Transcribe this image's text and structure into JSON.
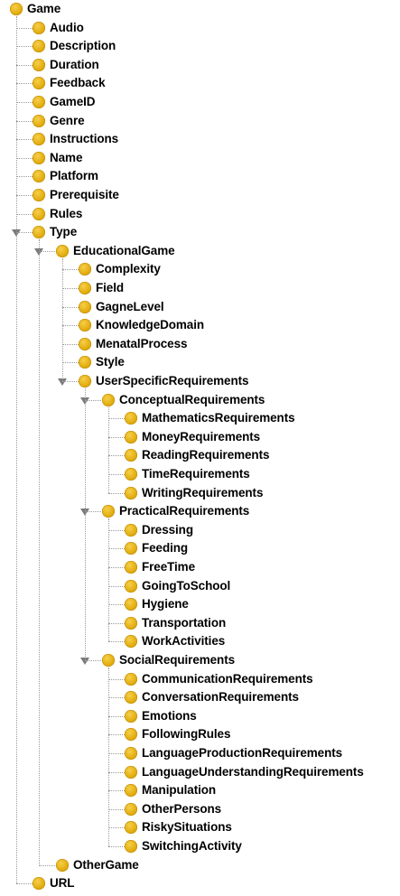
{
  "tree": {
    "label": "Game",
    "children": [
      {
        "label": "Audio"
      },
      {
        "label": "Description"
      },
      {
        "label": "Duration"
      },
      {
        "label": "Feedback"
      },
      {
        "label": "GameID"
      },
      {
        "label": "Genre"
      },
      {
        "label": "Instructions"
      },
      {
        "label": "Name"
      },
      {
        "label": "Platform"
      },
      {
        "label": "Prerequisite"
      },
      {
        "label": "Rules"
      },
      {
        "label": "Type",
        "expanded": true,
        "children": [
          {
            "label": "EducationalGame",
            "expanded": true,
            "children": [
              {
                "label": "Complexity"
              },
              {
                "label": "Field"
              },
              {
                "label": "GagneLevel"
              },
              {
                "label": "KnowledgeDomain"
              },
              {
                "label": "MenatalProcess"
              },
              {
                "label": "Style"
              },
              {
                "label": "UserSpecificRequirements",
                "expanded": true,
                "children": [
                  {
                    "label": "ConceptualRequirements",
                    "expanded": true,
                    "children": [
                      {
                        "label": "MathematicsRequirements"
                      },
                      {
                        "label": "MoneyRequirements"
                      },
                      {
                        "label": "ReadingRequirements"
                      },
                      {
                        "label": "TimeRequirements"
                      },
                      {
                        "label": "WritingRequirements"
                      }
                    ]
                  },
                  {
                    "label": "PracticalRequirements",
                    "expanded": true,
                    "children": [
                      {
                        "label": "Dressing"
                      },
                      {
                        "label": "Feeding"
                      },
                      {
                        "label": "FreeTime"
                      },
                      {
                        "label": "GoingToSchool"
                      },
                      {
                        "label": "Hygiene"
                      },
                      {
                        "label": "Transportation"
                      },
                      {
                        "label": "WorkActivities"
                      }
                    ]
                  },
                  {
                    "label": "SocialRequirements",
                    "expanded": true,
                    "children": [
                      {
                        "label": "CommunicationRequirements"
                      },
                      {
                        "label": "ConversationRequirements"
                      },
                      {
                        "label": "Emotions"
                      },
                      {
                        "label": "FollowingRules"
                      },
                      {
                        "label": "LanguageProductionRequirements"
                      },
                      {
                        "label": "LanguageUnderstandingRequirements"
                      },
                      {
                        "label": "Manipulation"
                      },
                      {
                        "label": "OtherPersons"
                      },
                      {
                        "label": "RiskySituations"
                      },
                      {
                        "label": "SwitchingActivity"
                      }
                    ]
                  }
                ]
              }
            ]
          },
          {
            "label": "OtherGame"
          }
        ]
      },
      {
        "label": "URL"
      }
    ]
  },
  "colors": {
    "bullet": "#e2ac0e",
    "connector": "#9a9a9a",
    "toggle": "#7a7a7a",
    "text": "#000000"
  },
  "icons": {
    "node": "class-bullet-icon",
    "expanded": "expand-triangle-icon"
  }
}
